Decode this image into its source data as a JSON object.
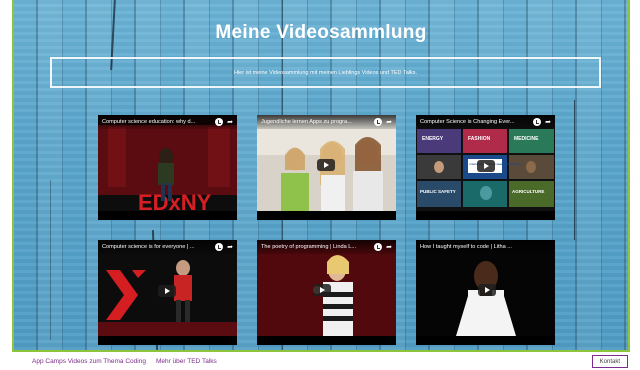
{
  "page": {
    "title": "Meine Videosammlung",
    "intro": "Hier ist meine Videosammlung mit meinen Lieblings Videos und TED Talks."
  },
  "videos": [
    {
      "title": "Computer science education: why d..."
    },
    {
      "title": "Jugendliche lernen Apps zu progra..."
    },
    {
      "title": "Computer Science is Changing Ever..."
    },
    {
      "title": "Computer science is for everyone | ..."
    },
    {
      "title": "The poetry of programming | Linda L..."
    },
    {
      "title": "How I taught myself to code | Litha ..."
    }
  ],
  "thumb3_labels": [
    "ENERGY",
    "FASHION",
    "MEDICINE",
    "COMPUTER SCIENCE IS CHANGING EVERYTHING",
    "PUBLIC SAFETY",
    "AGRICULTURE"
  ],
  "footer": {
    "link1": "App Camps Videos zum Thema Coding",
    "link2": "Mehr über TED Talks",
    "contact": "Kontakt"
  },
  "colors": {
    "frame_border": "#8cc43c",
    "link": "#7a2d8a",
    "background": "#5aa6cc"
  }
}
